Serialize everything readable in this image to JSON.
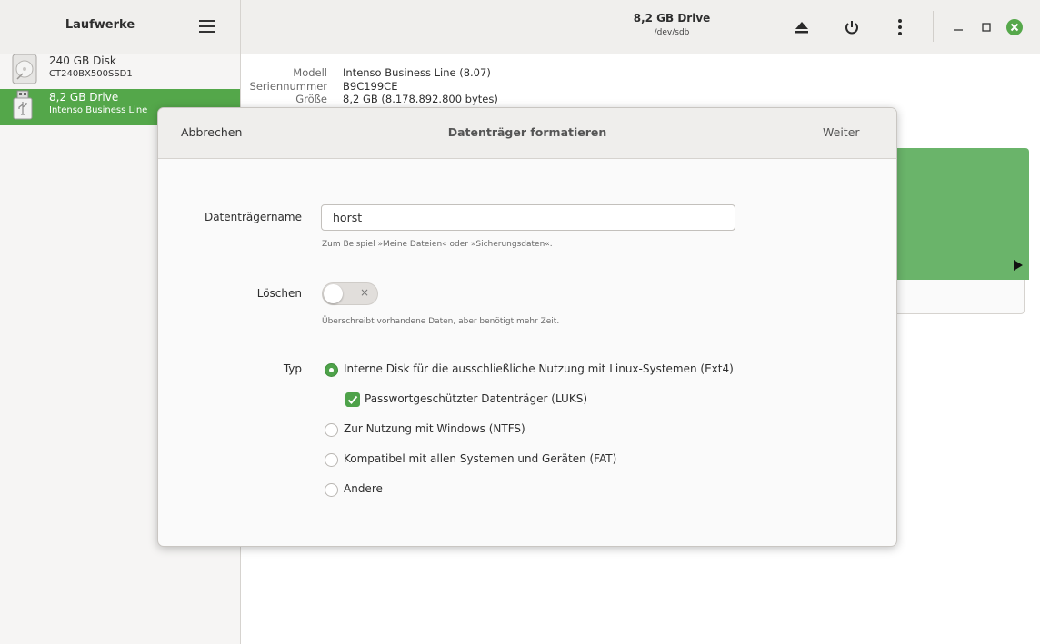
{
  "colors": {
    "accent": "#54a74a",
    "volume": "#6ab46a"
  },
  "sidebar": {
    "title": "Laufwerke",
    "menu_icon": "hamburger-icon",
    "drives": [
      {
        "name": "240 GB Disk",
        "model": "CT240BX500SSD1",
        "icon": "hard-disk-icon",
        "selected": false
      },
      {
        "name": "8,2 GB Drive",
        "model": "Intenso Business Line",
        "icon": "usb-drive-icon",
        "selected": true
      }
    ]
  },
  "header": {
    "title": "8,2 GB Drive",
    "subtitle": "/dev/sdb",
    "icons": [
      "eject-icon",
      "power-icon",
      "more-vertical-icon",
      "minimize-icon",
      "maximize-icon",
      "close-icon"
    ]
  },
  "drive_info": {
    "model_label": "Modell",
    "model_value": "Intenso Business Line (8.07)",
    "serial_label": "Seriennummer",
    "serial_value": "B9C199CE",
    "size_label": "Größe",
    "size_value": "8,2 GB (8.178.892.800 bytes)"
  },
  "dialog": {
    "cancel_label": "Abbrechen",
    "title": "Datenträger formatieren",
    "next_label": "Weiter",
    "name_label": "Datenträgername",
    "name_value": "horst",
    "name_hint": "Zum Beispiel »Meine Dateien« oder »Sicherungsdaten«.",
    "erase_label": "Löschen",
    "erase_on": false,
    "erase_hint": "Überschreibt vorhandene Daten, aber benötigt mehr Zeit.",
    "type_label": "Typ",
    "type_options": [
      {
        "label": "Interne Disk für die ausschließliche Nutzung mit Linux-Systemen (Ext4)",
        "selected": true
      },
      {
        "label": "Zur Nutzung mit Windows (NTFS)",
        "selected": false
      },
      {
        "label": "Kompatibel mit allen Systemen und Geräten (FAT)",
        "selected": false
      },
      {
        "label": "Andere",
        "selected": false
      }
    ],
    "luks_label": "Passwortgeschützter Datenträger (LUKS)",
    "luks_checked": true
  }
}
